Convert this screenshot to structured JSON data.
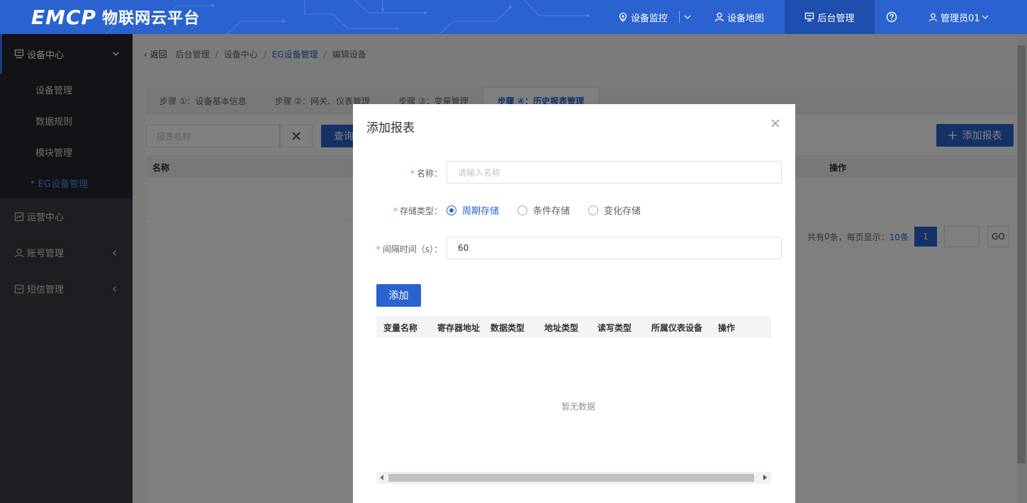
{
  "header": {
    "brand": "EMCP",
    "title": "物联网云平台",
    "nav": {
      "monitor": "设备监控",
      "map": "设备地图",
      "admin": "后台管理",
      "user": "管理员01"
    }
  },
  "sidebar": {
    "device_center": "设备中心",
    "sub_items": [
      "设备管理",
      "数据规则",
      "模块管理",
      "EG设备管理"
    ],
    "operation_center": "运营中心",
    "account_mgmt": "账号管理",
    "sms_mgmt": "短信管理"
  },
  "breadcrumb": {
    "back": "返回",
    "items": [
      "后台管理",
      "设备中心",
      "EG设备管理",
      "编辑设备"
    ]
  },
  "tabs": [
    "步骤 ①：设备基本信息",
    "步骤 ②：网关、仪表管理",
    "步骤 ③：变量管理",
    "步骤 ④：历史报表管理"
  ],
  "toolbar": {
    "search_placeholder": "报表名称",
    "query_label": "查询",
    "add_report_label": "添加报表"
  },
  "list": {
    "col_name": "名称",
    "col_op": "操作"
  },
  "pager": {
    "prefix": "共有",
    "total": "0",
    "mid": "条，每页显示：",
    "per_page": "10条",
    "page": "1",
    "go": "GO"
  },
  "dialog": {
    "title": "添加报表",
    "name_label": "名称：",
    "name_placeholder": "请输入名称",
    "storage_label": "存储类型：",
    "storage_options": [
      "周期存储",
      "条件存储",
      "变化存储"
    ],
    "storage_selected": "周期存储",
    "interval_label": "间隔时间（s）：",
    "interval_value": "60",
    "add_label": "添加",
    "columns": [
      "变量名称",
      "寄存器地址",
      "数据类型",
      "地址类型",
      "读写类型",
      "所属仪表设备",
      "操作"
    ],
    "empty_text": "暂无数据"
  },
  "colors": {
    "primary": "#2a63cf",
    "sidebar_bg": "#3a3d45",
    "required": "#f56c6c"
  }
}
